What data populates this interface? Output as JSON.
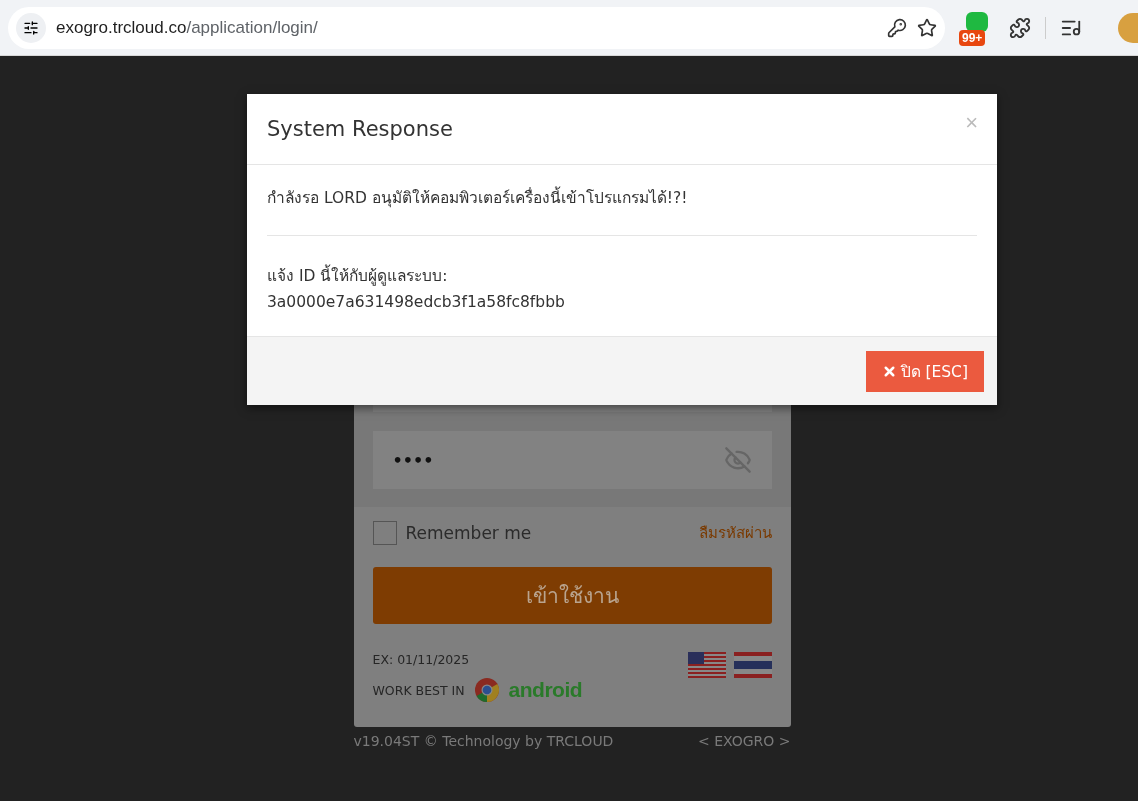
{
  "browser": {
    "url_host": "exogro.trcloud.co",
    "url_path": "/application/login/",
    "extension_badge": "99+"
  },
  "modal": {
    "title": "System Response",
    "close_glyph": "×",
    "message": "กำลังรอ LORD อนุมัติให้คอมพิวเตอร์เครื่องนี้เข้าโปรแกรมได้!?!",
    "id_label": "แจ้ง ID นี้ให้กับผู้ดูแลระบบ:",
    "id_value": "3a0000e7a631498edcb3f1a58fc8fbbb",
    "close_button": "ปิด [ESC]"
  },
  "login": {
    "password_value": "••••",
    "remember": {
      "label": "Remember me",
      "checked": false
    },
    "forgot_link": "ลืมรหัสผ่าน",
    "submit": "เข้าใช้งาน",
    "expiry": "EX: 01/11/2025",
    "work_best": "WORK BEST IN",
    "android": "android"
  },
  "footer": {
    "version": "v19.04ST © Technology by TRCLOUD",
    "brand": "< EXOGRO >"
  }
}
